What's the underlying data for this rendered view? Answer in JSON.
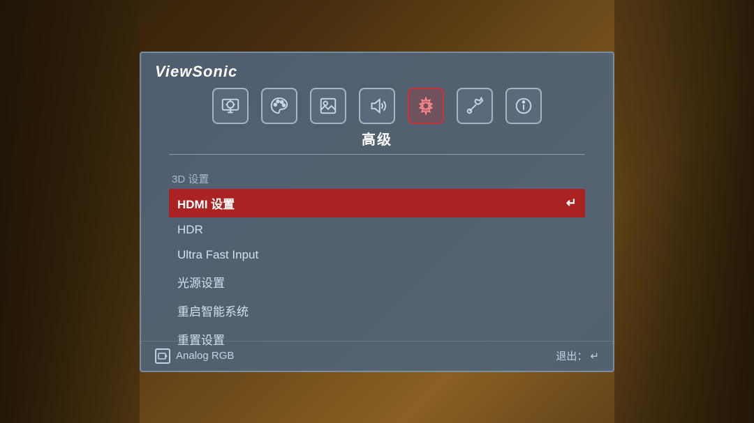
{
  "brand": "ViewSonic",
  "nav": {
    "icons": [
      {
        "name": "display-icon",
        "label": "显示",
        "active": false
      },
      {
        "name": "color-icon",
        "label": "颜色",
        "active": false
      },
      {
        "name": "image-icon",
        "label": "图像",
        "active": false
      },
      {
        "name": "audio-icon",
        "label": "音频",
        "active": false
      },
      {
        "name": "advanced-icon",
        "label": "高级",
        "active": true
      },
      {
        "name": "setup-icon",
        "label": "设置",
        "active": false
      },
      {
        "name": "info-icon",
        "label": "信息",
        "active": false
      }
    ],
    "activeSection": "高级"
  },
  "menu": {
    "sectionLabel": "3D 设置",
    "items": [
      {
        "id": "hdmi-settings",
        "label": "HDMI 设置",
        "selected": true,
        "hasArrow": true
      },
      {
        "id": "hdr",
        "label": "HDR",
        "selected": false,
        "hasArrow": false
      },
      {
        "id": "ultra-fast-input",
        "label": "Ultra Fast Input",
        "selected": false,
        "hasArrow": false
      },
      {
        "id": "light-source",
        "label": "光源设置",
        "selected": false,
        "hasArrow": false
      },
      {
        "id": "reset-smart",
        "label": "重启智能系统",
        "selected": false,
        "hasArrow": false
      },
      {
        "id": "reset-settings",
        "label": "重置设置",
        "selected": false,
        "hasArrow": false
      }
    ]
  },
  "footer": {
    "inputLabel": "Analog RGB",
    "exitLabel": "退出：",
    "exitIcon": "↵"
  }
}
